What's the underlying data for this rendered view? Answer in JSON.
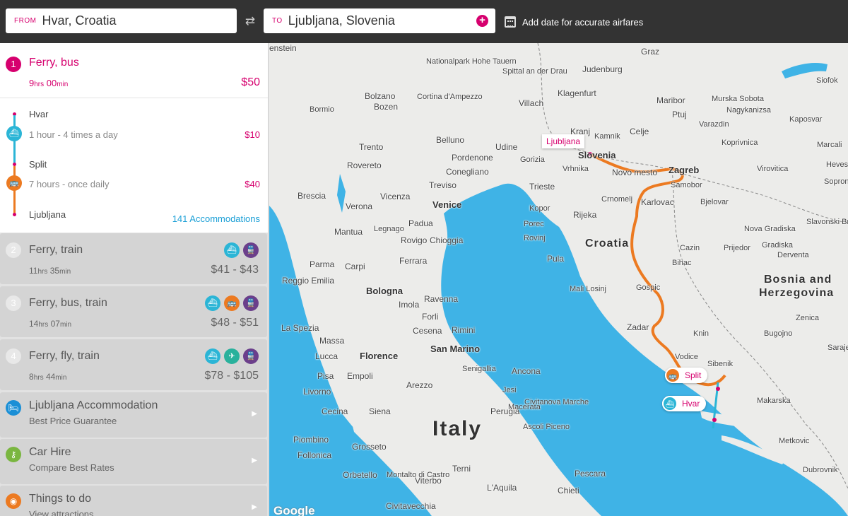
{
  "search": {
    "from_label": "FROM",
    "from_value": "Hvar, Croatia",
    "to_label": "TO",
    "to_value": "Ljubljana, Slovenia",
    "swap_icon": "swap-arrows-icon",
    "add_icon": "plus-icon",
    "date_text": "Add date for accurate airfares"
  },
  "route1": {
    "num": "1",
    "title": "Ferry, bus",
    "dur_h": "9",
    "dur_h_unit": "hrs",
    "dur_m": "00",
    "dur_m_unit": "min",
    "price": "$50",
    "stops": [
      "Hvar",
      "Split",
      "Ljubljana"
    ],
    "legs": [
      {
        "mode": "ferry",
        "text": "1 hour - 4 times a day",
        "price": "$10"
      },
      {
        "mode": "bus",
        "text": "7 hours - once daily",
        "price": "$40"
      }
    ],
    "accommodations": "141 Accommodations"
  },
  "alt_routes": [
    {
      "num": "2",
      "title": "Ferry, train",
      "dur_h": "11",
      "dur_m": "35",
      "price": "$41 - $43",
      "modes": [
        "ferry",
        "train"
      ]
    },
    {
      "num": "3",
      "title": "Ferry, bus, train",
      "dur_h": "14",
      "dur_m": "07",
      "price": "$48 - $51",
      "modes": [
        "ferry",
        "bus",
        "train"
      ]
    },
    {
      "num": "4",
      "title": "Ferry, fly, train",
      "dur_h": "8",
      "dur_m": "44",
      "price": "$78 - $105",
      "modes": [
        "ferry",
        "fly",
        "train"
      ]
    }
  ],
  "units": {
    "hrs": "hrs",
    "min": "min"
  },
  "promos": [
    {
      "title": "Ljubljana Accommodation",
      "sub": "Best Price Guarantee",
      "icon": "bed-icon",
      "color": "#1a8fd6"
    },
    {
      "title": "Car Hire",
      "sub": "Compare Best Rates",
      "icon": "key-icon",
      "color": "#7ab640"
    },
    {
      "title": "Things to do",
      "sub": "View attractions",
      "icon": "camera-icon",
      "color": "#ec7a21"
    }
  ],
  "colors": {
    "accent": "#d6006e",
    "ferry": "#2bb5d6",
    "bus": "#ec7a21",
    "train": "#6b3f8b",
    "fly": "#29b19c",
    "sea": "#3fb3e6",
    "route": "#ec7a21"
  },
  "map": {
    "pins": {
      "ljubljana": "Ljubljana",
      "split": "Split",
      "hvar": "Hvar"
    },
    "countries": {
      "italy": "Italy",
      "croatia": "Croatia",
      "slovenia": "Slovenia",
      "bosnia1": "Bosnia and",
      "bosnia2": "Herzegovina"
    },
    "attribution": "Google",
    "cities": [
      "Graz",
      "Judenburg",
      "Spittal an der Drau",
      "Klagenfurt",
      "Villach",
      "Maribor",
      "Ptuj",
      "Kranj",
      "Kamnik",
      "Celje",
      "Vrhnika",
      "Novo mesto",
      "Zagreb",
      "Samobor",
      "Karlovac",
      "Crnomelj",
      "Rijeka",
      "Kopor",
      "Trieste",
      "Gorizia",
      "Udine",
      "Pordenone",
      "Conegliano",
      "Treviso",
      "Belluno",
      "Venice",
      "Padua",
      "Vicenza",
      "Verona",
      "Rovereto",
      "Trento",
      "Bolzano",
      "Bozen",
      "Bormio",
      "Brescia",
      "Mantua",
      "Legnago",
      "Rovigo",
      "Chioggia",
      "Ferrara",
      "Parma",
      "Carpi",
      "Reggio Emilia",
      "Bologna",
      "Imola",
      "Forli",
      "Ravenna",
      "Cesena",
      "Rimini",
      "San Marino",
      "La Spezia",
      "Massa",
      "Lucca",
      "Pisa",
      "Empoli",
      "Florence",
      "Livorno",
      "Cecina",
      "Arezzo",
      "Piombino",
      "Follonica",
      "Grosseto",
      "Orbetello",
      "Siena",
      "Perugia",
      "Ancona",
      "Senigallia",
      "Jesi",
      "Macerata",
      "Civitanova Marche",
      "Ascoli Piceno",
      "Pescara",
      "Chieti",
      "L'Aquila",
      "Terni",
      "Viterbo",
      "Montalto di Castro",
      "Civitavecchia",
      "Pula",
      "Rovinj",
      "Porec",
      "Mali Losinj",
      "Gospic",
      "Bihac",
      "Zadar",
      "Knin",
      "Vodice",
      "Sibenik",
      "Makarska",
      "Metkovic",
      "Dubrovnik",
      "Bugojno",
      "Zenica",
      "Sarajevo",
      "Cazin",
      "Prijedor",
      "Gradiska",
      "Derventa",
      "Nova Gradiska",
      "Slavonski Brod",
      "Bjelovar",
      "Virovitica",
      "Koprivnica",
      "Varazdin",
      "Nagykanizsa",
      "Kaposvar",
      "Siofok",
      "Marcali",
      "Hevesz",
      "Sopron",
      "Murska Sobota",
      "Nationalpark Hohe Tauern",
      "Cortina d'Ampezzo"
    ]
  }
}
